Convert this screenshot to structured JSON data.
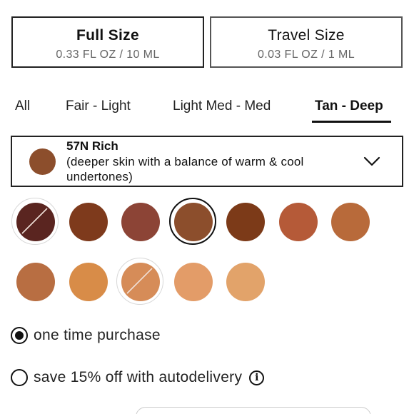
{
  "sizes": [
    {
      "title": "Full Size",
      "sub": "0.33 FL OZ / 10 ML",
      "selected": true
    },
    {
      "title": "Travel Size",
      "sub": "0.03 FL OZ / 1 ML",
      "selected": false
    }
  ],
  "tabs": [
    {
      "label": "All",
      "active": false
    },
    {
      "label": "Fair - Light",
      "active": false
    },
    {
      "label": "Light Med - Med",
      "active": false
    },
    {
      "label": "Tan - Deep",
      "active": true
    }
  ],
  "selected_shade": {
    "name": "57N Rich",
    "description": "(deeper skin with a balance of warm & cool undertones)",
    "color": "#8c4e2c",
    "icon": "chevron-down-icon"
  },
  "swatches": [
    {
      "color": "#5a2520",
      "unavailable": true,
      "selected": false
    },
    {
      "color": "#7e3a1c",
      "unavailable": false,
      "selected": false
    },
    {
      "color": "#8c4436",
      "unavailable": false,
      "selected": false
    },
    {
      "color": "#8c4e2c",
      "unavailable": false,
      "selected": true
    },
    {
      "color": "#7c3a18",
      "unavailable": false,
      "selected": false
    },
    {
      "color": "#b55a38",
      "unavailable": false,
      "selected": false
    },
    {
      "color": "#b86a3a",
      "unavailable": false,
      "selected": false
    },
    {
      "color": "#b86e42",
      "unavailable": false,
      "selected": false
    },
    {
      "color": "#d88c48",
      "unavailable": false,
      "selected": false
    },
    {
      "color": "#d68c58",
      "unavailable": true,
      "selected": false
    },
    {
      "color": "#e39c68",
      "unavailable": false,
      "selected": false
    },
    {
      "color": "#e2a36a",
      "unavailable": false,
      "selected": false
    }
  ],
  "purchase": {
    "one_time": {
      "label": "one time purchase",
      "checked": true
    },
    "autodelivery": {
      "label": "save 15% off with autodelivery",
      "checked": false,
      "icon": "info-icon",
      "icon_glyph": "i"
    }
  }
}
